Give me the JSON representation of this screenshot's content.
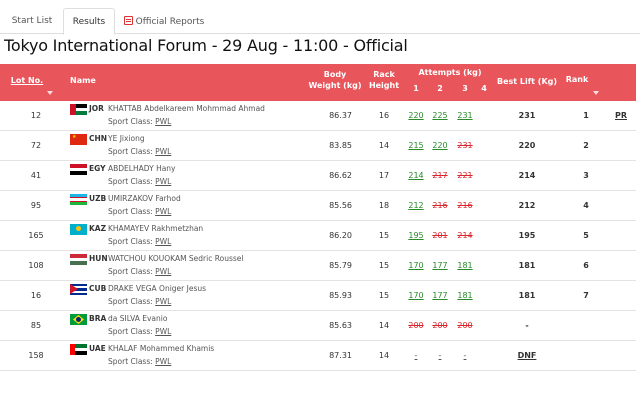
{
  "tabs": [
    {
      "label": "Start List"
    },
    {
      "label": "Results"
    },
    {
      "label": "Official Reports"
    }
  ],
  "page_title": "Tokyo International Forum - 29 Aug - 11:00 - Official",
  "header": {
    "lot_no": "Lot No.",
    "name": "Name",
    "body_weight_1": "Body",
    "body_weight_2": "Weight (kg)",
    "rack_1": "Rack",
    "rack_2": "Height",
    "attempts": "Attempts (kg)",
    "attempt_nums": [
      "1",
      "2",
      "3",
      "4"
    ],
    "best_lift": "Best Lift (Kg)",
    "rank": "Rank"
  },
  "sport_class_label": "Sport Class:",
  "rows": [
    {
      "lot": "12",
      "nat": "JOR",
      "name": "KHATTAB Abdelkareem Mohmmad Ahmad",
      "sport_class": "PWL",
      "bw": "86.37",
      "rack": "16",
      "a1": "220",
      "a2": "225",
      "a3": "231",
      "best": "231",
      "rank": "1",
      "record": "PR"
    },
    {
      "lot": "72",
      "nat": "CHN",
      "name": "YE Jixiong",
      "sport_class": "PWL",
      "bw": "83.85",
      "rack": "14",
      "a1": "215",
      "a2": "220",
      "a3": "231",
      "best": "220",
      "rank": "2",
      "record": ""
    },
    {
      "lot": "41",
      "nat": "EGY",
      "name": "ABDELHADY Hany",
      "sport_class": "PWL",
      "bw": "86.62",
      "rack": "17",
      "a1": "214",
      "a2": "217",
      "a3": "221",
      "best": "214",
      "rank": "3",
      "record": ""
    },
    {
      "lot": "95",
      "nat": "UZB",
      "name": "UMIRZAKOV Farhod",
      "sport_class": "PWL",
      "bw": "85.56",
      "rack": "18",
      "a1": "212",
      "a2": "216",
      "a3": "216",
      "best": "212",
      "rank": "4",
      "record": ""
    },
    {
      "lot": "165",
      "nat": "KAZ",
      "name": "KHAMAYEV Rakhmetzhan",
      "sport_class": "PWL",
      "bw": "86.20",
      "rack": "15",
      "a1": "195",
      "a2": "201",
      "a3": "214",
      "best": "195",
      "rank": "5",
      "record": ""
    },
    {
      "lot": "108",
      "nat": "HUN",
      "name": "WATCHOU KOUOKAM Sedric Roussel",
      "sport_class": "PWL",
      "bw": "85.79",
      "rack": "15",
      "a1": "170",
      "a2": "177",
      "a3": "181",
      "best": "181",
      "rank": "6",
      "record": ""
    },
    {
      "lot": "16",
      "nat": "CUB",
      "name": "DRAKE VEGA Oniger Jesus",
      "sport_class": "PWL",
      "bw": "85.93",
      "rack": "15",
      "a1": "170",
      "a2": "177",
      "a3": "181",
      "best": "181",
      "rank": "7",
      "record": ""
    },
    {
      "lot": "85",
      "nat": "BRA",
      "name": "da SILVA Evanio",
      "sport_class": "PWL",
      "bw": "85.63",
      "rack": "14",
      "a1": "200",
      "a2": "200",
      "a3": "200",
      "best": "-",
      "rank": "",
      "record": ""
    },
    {
      "lot": "158",
      "nat": "UAE",
      "name": "KHALAF Mohammed Khamis",
      "sport_class": "PWL",
      "bw": "87.31",
      "rack": "14",
      "a1": "-",
      "a2": "-",
      "a3": "-",
      "best": "DNF",
      "rank": "",
      "record": ""
    }
  ],
  "colors": {
    "header_bg": "#e8565c",
    "good_lift": "#2a8a2a",
    "no_lift": "#d9262c"
  }
}
